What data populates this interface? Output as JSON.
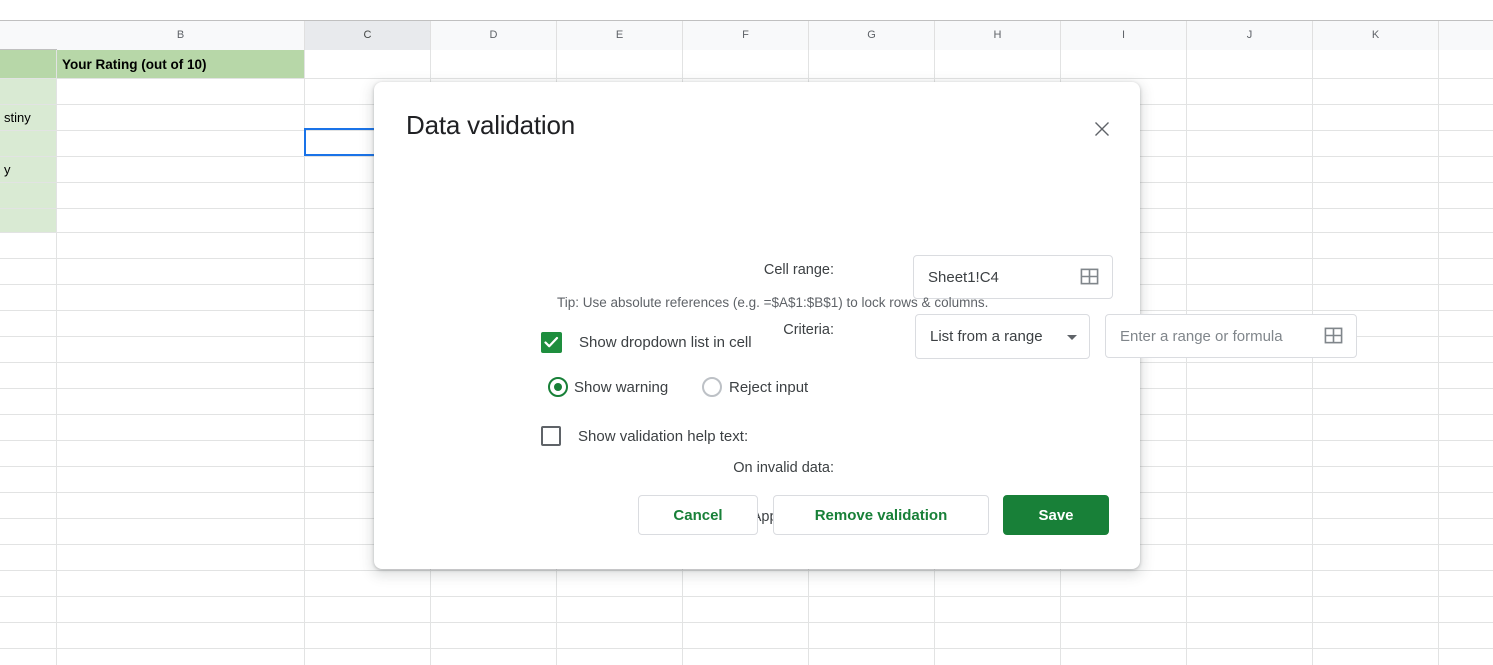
{
  "spreadsheet": {
    "column_headers": [
      "B",
      "C",
      "D",
      "E",
      "F",
      "G",
      "H",
      "I",
      "J",
      "K"
    ],
    "selected_column": "C",
    "selected_cell": "C4",
    "cells": {
      "b1": "Your Rating (out of 10)",
      "a3": "stiny",
      "a5": "y"
    }
  },
  "dialog": {
    "title": "Data validation",
    "close_icon": "close-icon",
    "cell_range": {
      "label": "Cell range:",
      "value": "Sheet1!C4",
      "picker_icon": "grid-picker-icon"
    },
    "criteria": {
      "label": "Criteria:",
      "selected": "List from a range",
      "caret_icon": "chevron-down-icon",
      "range_placeholder": "Enter a range or formula",
      "range_value": "",
      "picker_icon": "grid-picker-icon",
      "tip": "Tip: Use absolute references (e.g. =$A$1:$B$1) to lock rows & columns."
    },
    "show_dropdown": {
      "label": "Show dropdown list in cell",
      "checked": true,
      "icon": "checkmark-icon"
    },
    "on_invalid_data": {
      "label": "On invalid data:",
      "options": [
        {
          "label": "Show warning",
          "selected": true
        },
        {
          "label": "Reject input",
          "selected": false
        }
      ]
    },
    "appearance": {
      "label": "Appearance:",
      "checkbox_label": "Show validation help text:",
      "checked": false
    },
    "buttons": {
      "cancel": "Cancel",
      "remove": "Remove validation",
      "save": "Save"
    }
  },
  "colors": {
    "accent_green": "#188038",
    "checkbox_green": "#1e8e3e",
    "selection_blue": "#1a73e8",
    "header_green": "#b7d7a8",
    "cell_green": "#d9ead3"
  }
}
